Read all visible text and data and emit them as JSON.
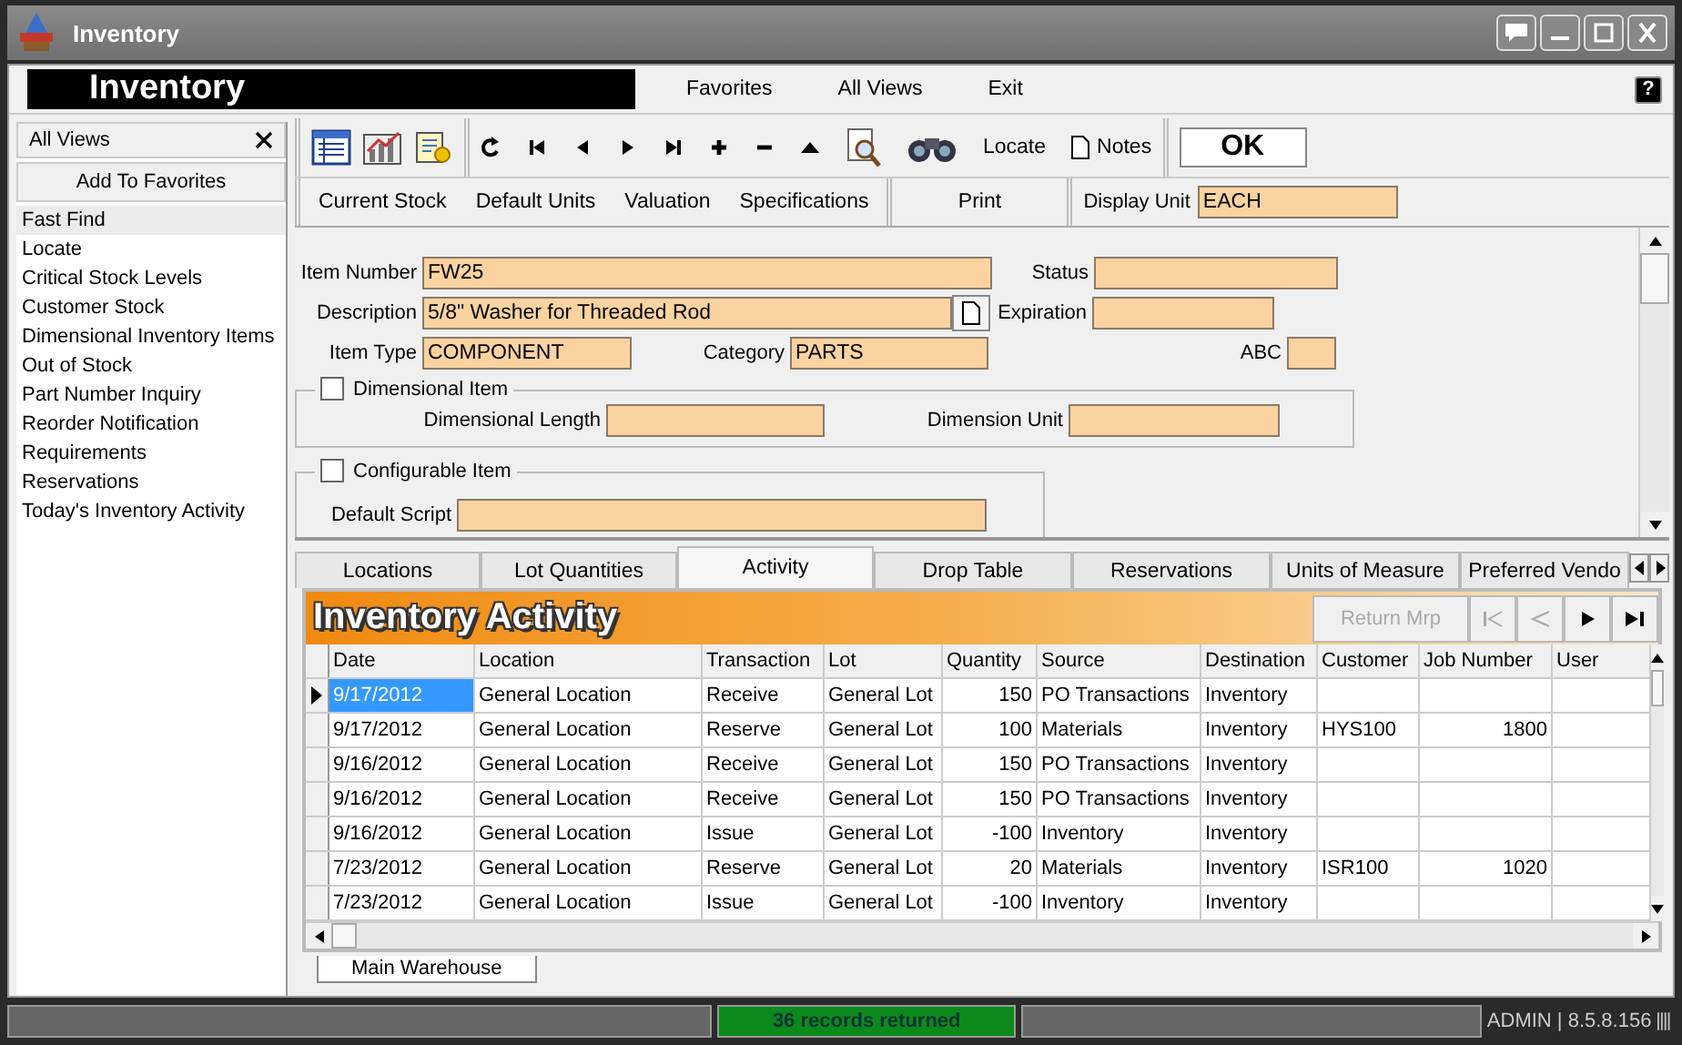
{
  "window": {
    "title": "Inventory"
  },
  "menu_bar": {
    "module_title": "Inventory",
    "items": [
      "Favorites",
      "All Views",
      "Exit"
    ],
    "help": "?"
  },
  "sidebar": {
    "header": "All Views",
    "add_button": "Add To Favorites",
    "items": [
      {
        "label": "Fast Find",
        "selected": true
      },
      {
        "label": "Locate",
        "selected": false
      },
      {
        "label": "Critical Stock Levels",
        "selected": false
      },
      {
        "label": "Customer Stock",
        "selected": false
      },
      {
        "label": "Dimensional Inventory Items",
        "selected": false
      },
      {
        "label": "Out of Stock",
        "selected": false
      },
      {
        "label": "Part Number Inquiry",
        "selected": false
      },
      {
        "label": "Reorder Notification",
        "selected": false
      },
      {
        "label": "Requirements",
        "selected": false
      },
      {
        "label": "Reservations",
        "selected": false
      },
      {
        "label": "Today's Inventory Activity",
        "selected": false
      }
    ]
  },
  "toolbar": {
    "locate": "Locate",
    "notes": "Notes",
    "ok": "OK"
  },
  "sub_toolbar": {
    "links": [
      "Current Stock",
      "Default Units",
      "Valuation",
      "Specifications"
    ],
    "print": "Print",
    "display_unit": {
      "label": "Display Unit",
      "value": "EACH"
    }
  },
  "form": {
    "item_number": {
      "label": "Item Number",
      "value": "FW25"
    },
    "status": {
      "label": "Status"
    },
    "description": {
      "label": "Description",
      "value": "5/8\" Washer for Threaded Rod"
    },
    "expiration": {
      "label": "Expiration"
    },
    "item_type": {
      "label": "Item Type",
      "value": "COMPONENT"
    },
    "category": {
      "label": "Category",
      "value": "PARTS"
    },
    "abc": {
      "label": "ABC"
    },
    "dimensional_item": {
      "label": "Dimensional Item",
      "checked": false,
      "length_label": "Dimensional Length",
      "unit_label": "Dimension Unit"
    },
    "configurable_item": {
      "label": "Configurable Item",
      "checked": false,
      "script_label": "Default Script"
    }
  },
  "tabs": [
    {
      "label": "Locations",
      "selected": false
    },
    {
      "label": "Lot Quantities",
      "selected": false
    },
    {
      "label": "Activity",
      "selected": true
    },
    {
      "label": "Drop Table",
      "selected": false
    },
    {
      "label": "Reservations",
      "selected": false
    },
    {
      "label": "Units of Measure",
      "selected": false
    },
    {
      "label": "Preferred Vendo",
      "selected": false
    }
  ],
  "grid": {
    "title": "Inventory Activity",
    "return_button": {
      "label": "Return Mrp",
      "disabled": true
    },
    "nav": [
      {
        "kind": "first",
        "disabled": true
      },
      {
        "kind": "prev",
        "disabled": true
      },
      {
        "kind": "next",
        "disabled": false
      },
      {
        "kind": "last",
        "disabled": false
      }
    ],
    "columns": [
      "Date",
      "Location",
      "Transaction",
      "Lot",
      "Quantity",
      "Source",
      "Destination",
      "Customer",
      "Job Number",
      "User"
    ],
    "rows": [
      {
        "selected": true,
        "cells": [
          "9/17/2012",
          "General Location",
          "Receive",
          "General Lot",
          "150",
          "PO Transactions",
          "Inventory",
          "",
          "",
          ""
        ]
      },
      {
        "selected": false,
        "cells": [
          "9/17/2012",
          "General Location",
          "Reserve",
          "General Lot",
          "100",
          "Materials",
          "Inventory",
          "HYS100",
          "1800",
          ""
        ]
      },
      {
        "selected": false,
        "cells": [
          "9/16/2012",
          "General Location",
          "Receive",
          "General Lot",
          "150",
          "PO Transactions",
          "Inventory",
          "",
          "",
          ""
        ]
      },
      {
        "selected": false,
        "cells": [
          "9/16/2012",
          "General Location",
          "Receive",
          "General Lot",
          "150",
          "PO Transactions",
          "Inventory",
          "",
          "",
          ""
        ]
      },
      {
        "selected": false,
        "cells": [
          "9/16/2012",
          "General Location",
          "Issue",
          "General Lot",
          "-100",
          "Inventory",
          "Inventory",
          "",
          "",
          ""
        ]
      },
      {
        "selected": false,
        "cells": [
          "7/23/2012",
          "General Location",
          "Reserve",
          "General Lot",
          "20",
          "Materials",
          "Inventory",
          "ISR100",
          "1020",
          ""
        ]
      },
      {
        "selected": false,
        "cells": [
          "7/23/2012",
          "General Location",
          "Issue",
          "General Lot",
          "-100",
          "Inventory",
          "Inventory",
          "",
          "",
          ""
        ]
      }
    ]
  },
  "bottom_tabs": [
    {
      "label": "Main Warehouse",
      "selected": true
    }
  ],
  "status_bar": {
    "message": "36 records returned",
    "version": "ADMIN | 8.5.8.156"
  }
}
